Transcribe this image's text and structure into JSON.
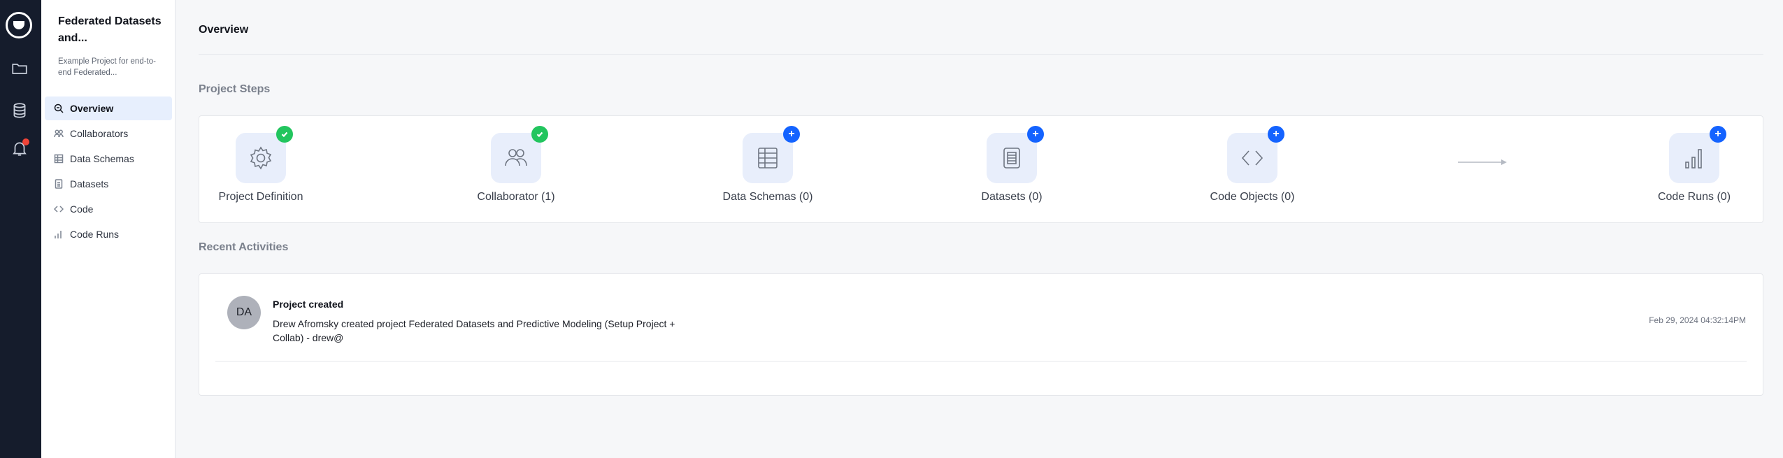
{
  "rail": {
    "items": [
      {
        "icon": "folder-icon"
      },
      {
        "icon": "database-icon"
      },
      {
        "icon": "bell-icon",
        "has_notification": true
      }
    ]
  },
  "project": {
    "title": "Federated Datasets and...",
    "description": "Example Project for end-to-end Federated..."
  },
  "nav": {
    "items": [
      {
        "label": "Overview",
        "icon": "overview-icon",
        "active": true
      },
      {
        "label": "Collaborators",
        "icon": "collaborators-icon"
      },
      {
        "label": "Data Schemas",
        "icon": "table-icon"
      },
      {
        "label": "Datasets",
        "icon": "dataset-icon"
      },
      {
        "label": "Code",
        "icon": "code-icon"
      },
      {
        "label": "Code Runs",
        "icon": "bar-chart-icon"
      }
    ]
  },
  "main": {
    "title": "Overview",
    "project_steps_title": "Project Steps",
    "recent_activities_title": "Recent Activities",
    "steps": [
      {
        "label": "Project Definition",
        "icon": "gear-icon",
        "status": "done"
      },
      {
        "label": "Collaborator (1)",
        "icon": "users-icon",
        "status": "done"
      },
      {
        "label": "Data Schemas (0)",
        "icon": "table-icon",
        "status": "add"
      },
      {
        "label": "Datasets (0)",
        "icon": "document-icon",
        "status": "add"
      },
      {
        "label": "Code Objects (0)",
        "icon": "code-icon",
        "status": "add"
      },
      {
        "label": "Code Runs (0)",
        "icon": "bar-chart-icon",
        "status": "add"
      }
    ],
    "activity": {
      "avatar_initials": "DA",
      "title": "Project created",
      "description": "Drew Afromsky created project Federated Datasets and Predictive Modeling (Setup Project + Collab) - drew@",
      "timestamp": "Feb 29, 2024 04:32:14PM"
    }
  },
  "colors": {
    "rail_bg": "#151c2c",
    "done_green": "#22c55e",
    "add_blue": "#1463ff",
    "active_nav_bg": "#e7effd"
  }
}
